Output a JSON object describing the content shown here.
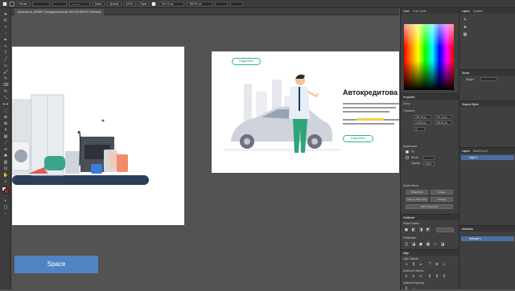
{
  "app": {
    "document_tab": "plunbook.ai_384657 Сотрудничество@ 16% (RGB/GPU Preview)",
    "toolbar": {
      "selection_label": "Stroke",
      "uniform": "Basic",
      "opacity_label": "Opacity",
      "opacity_value": "100%",
      "style_label": "Style",
      "w_value": "791.13 px",
      "h_value": "405.51 px"
    }
  },
  "canvas": {
    "artboard2": {
      "heading": "Автокредитова",
      "button_top": "Подробнее",
      "button_bottom": "Подробнее"
    },
    "space_overlay": "Space",
    "accent_colors": {
      "green": "#34b38a",
      "highlight": "#f6d04d",
      "space_blue": "#4f83c4"
    }
  },
  "panels": {
    "col1_tabs": [
      "Color",
      "Color Guide"
    ],
    "properties": {
      "title": "Properties",
      "group_label": "Group",
      "transform_label": "Transform",
      "x_value": "760.29 px",
      "y_value": "1226.8 px",
      "w_value": "791.13 px",
      "h_value": "405.51 px",
      "angle_value": "0°",
      "appearance_label": "Appearance",
      "fill_label": "Fill",
      "stroke_label": "Stroke",
      "opacity_label": "Opacity",
      "opacity_value": "100%",
      "quick_actions_label": "Quick Actions",
      "offset_path": "Offset Path",
      "isolate": "Isolate",
      "align_pixel": "Align to Pixel Grid",
      "arrange": "Arrange",
      "recolor": "Start Global Edit"
    },
    "pathfinder": {
      "title": "Pathfinder",
      "shape_modes": "Shape Modes:",
      "pathfinders": "Pathfinders:"
    },
    "align": {
      "title": "Align",
      "align_objects": "Align Objects:",
      "distribute_objects": "Distribute Objects:",
      "distribute_spacing": "Distribute Spacing:"
    },
    "col2_tabs": [
      "Layers",
      "Gradient"
    ],
    "stroke_panel": {
      "title": "Stroke",
      "weight_label": "Weight"
    },
    "graphic_styles_title": "Graphic Styles",
    "layers": {
      "tabs": [
        "Layers",
        "Asset Export"
      ],
      "items": [
        "Layer 1"
      ],
      "artboards_title": "Artboards",
      "artboards": [
        "Artboard 1"
      ]
    }
  }
}
